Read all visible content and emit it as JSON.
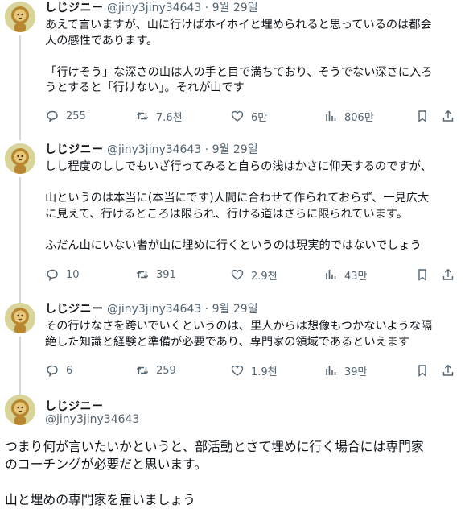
{
  "tweets": [
    {
      "name": "しじジニー",
      "handle": "@jiny3jiny34643",
      "date": "9월 29일",
      "text": "あえて言いますが、山に行けばホイホイと埋められると思っているのは都会\n人の感性であります。\n\n「行けそう」な深さの山は人の手と目で満ちており、そうでない深さに入ろ\nうとすると「行けない」。それが山です",
      "replies": "255",
      "retweets": "7.6천",
      "likes": "6만",
      "views": "806만"
    },
    {
      "name": "しじジニー",
      "handle": "@jiny3jiny34643",
      "date": "9월 29일",
      "text": "しし程度のししでもいざ行ってみると自らの浅はかさに仰天するのですが、\n\n山というのは本当に(本当にです)人間に合わせて作られておらず、一見広大\nに見えて、行けるところは限られ、行ける道はさらに限られています。\n\nふだん山にいない者が山に埋めに行くというのは現実的ではないでしょう",
      "replies": "10",
      "retweets": "391",
      "likes": "2.9천",
      "views": "43만"
    },
    {
      "name": "しじジニー",
      "handle": "@jiny3jiny34643",
      "date": "9월 29일",
      "text": "その行けなさを跨いでいくというのは、里人からは想像もつかないような隔\n絶した知識と経験と準備が必要であり、専門家の領域であるといえます",
      "replies": "6",
      "retweets": "259",
      "likes": "1.9천",
      "views": "39만"
    }
  ],
  "main_tweet": {
    "name": "しじジニー",
    "handle": "@jiny3jiny34643",
    "text": "つまり何が言いたいかというと、部活動とさて埋めに行く場合には専門家\nのコーチングが必要だと思います。\n\n山と埋めの専門家を雇いましょう"
  },
  "icons": {
    "reply": "speech-bubble-icon",
    "retweet": "retweet-arrows-icon",
    "like": "heart-icon",
    "views": "bar-chart-icon",
    "bookmark": "bookmark-icon",
    "share": "share-upload-icon"
  },
  "colors": {
    "text": "#0f1419",
    "secondary": "#536471",
    "thread_line": "#cfd9de",
    "avatar_bg": "#c9c77a"
  }
}
